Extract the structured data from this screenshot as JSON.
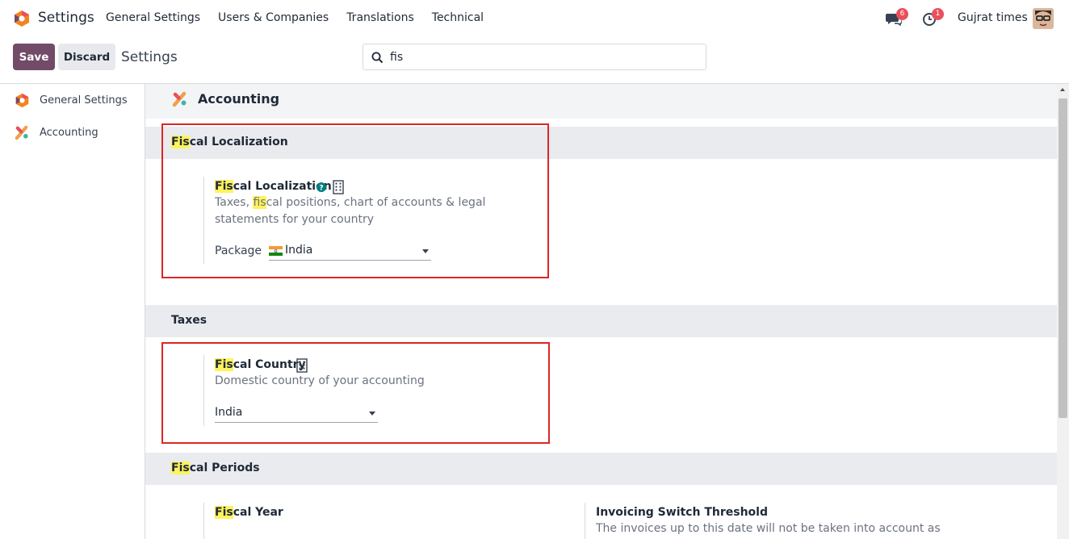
{
  "navbar": {
    "app_name": "Settings",
    "menu": [
      "General Settings",
      "Users & Companies",
      "Translations",
      "Technical"
    ],
    "messages_count": "6",
    "activities_count": "1",
    "user_name": "Gujrat times"
  },
  "control": {
    "save_label": "Save",
    "discard_label": "Discard",
    "title": "Settings",
    "search_value": "fis"
  },
  "sidebar": {
    "items": [
      {
        "label": "General Settings",
        "icon": "settings-hex-icon"
      },
      {
        "label": "Accounting",
        "icon": "accounting-icon"
      }
    ]
  },
  "main": {
    "app_title": "Accounting",
    "sections": {
      "fiscal_localization": {
        "title_hl": "Fis",
        "title_rest": "cal Localization",
        "setting": {
          "name_hl": "Fis",
          "name_rest": "cal Localization",
          "desc_pre": "Taxes, ",
          "desc_hl": "fis",
          "desc_post": "cal positions, chart of accounts & legal statements for your country",
          "field_label": "Package",
          "field_value": "India"
        }
      },
      "taxes": {
        "title": "Taxes",
        "setting": {
          "name_hl": "Fis",
          "name_rest": "cal Country",
          "desc": "Domestic country of your accounting",
          "field_value": "India"
        }
      },
      "fiscal_periods": {
        "title_hl": "Fis",
        "title_rest": "cal Periods",
        "setting_left": {
          "name_hl": "Fis",
          "name_rest": "cal Year"
        },
        "setting_right": {
          "name": "Invoicing Switch Threshold",
          "desc": "The invoices up to this date will not be taken into account as"
        }
      }
    }
  },
  "colors": {
    "primary": "#714b67",
    "highlight": "#fff35c",
    "annotation": "#dc2626",
    "badge": "#e8505b"
  }
}
